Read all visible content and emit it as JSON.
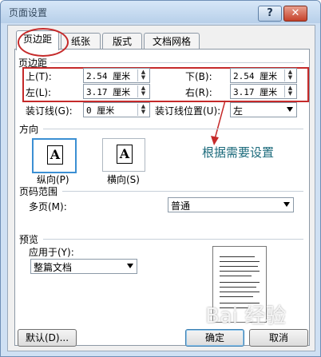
{
  "window": {
    "title": "页面设置",
    "help_glyph": "?",
    "close_glyph": "✕"
  },
  "tabs": [
    "页边距",
    "纸张",
    "版式",
    "文档网格"
  ],
  "margins": {
    "section_label": "页边距",
    "top_label": "上(T):",
    "top_value": "2.54 厘米",
    "bottom_label": "下(B):",
    "bottom_value": "2.54 厘米",
    "left_label": "左(L):",
    "left_value": "3.17 厘米",
    "right_label": "右(R):",
    "right_value": "3.17 厘米",
    "gutter_label": "装订线(G):",
    "gutter_value": "0 厘米",
    "gutter_pos_label": "装订线位置(U):",
    "gutter_pos_value": "左"
  },
  "orientation": {
    "section_label": "方向",
    "portrait_label": "纵向(P)",
    "landscape_label": "横向(S)",
    "glyph": "A",
    "selected": "portrait"
  },
  "annotation": "根据需要设置",
  "pages": {
    "section_label": "页码范围",
    "multiple_label": "多页(M):",
    "multiple_value": "普通"
  },
  "preview": {
    "section_label": "预览",
    "apply_label": "应用于(Y):",
    "apply_value": "整篇文档"
  },
  "buttons": {
    "default": "默认(D)...",
    "ok": "确定",
    "cancel": "取消"
  },
  "watermark": "Bai 经验",
  "colors": {
    "highlight_red": "#c52a2a",
    "annotation": "#1b6a7b",
    "selected_border": "#3b8fd3"
  }
}
